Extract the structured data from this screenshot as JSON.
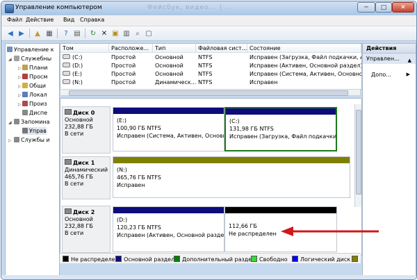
{
  "window": {
    "title": "Управление компьютером",
    "ghost_title": "Фейсбук, видео... | ...",
    "btn_min": "─",
    "btn_max": "□",
    "btn_close": "✕"
  },
  "menu": [
    "Файл",
    "Действие",
    "Вид",
    "Справка"
  ],
  "toolbar_icons": [
    "back-arrow-icon",
    "forward-arrow-icon",
    "folder-up-icon",
    "console-tree-icon",
    "help-icon",
    "view-icon",
    "refresh-icon",
    "delete-icon",
    "export-icon",
    "properties-icon",
    "zoom-icon",
    "new-window-icon"
  ],
  "tree": {
    "root": "Управление к",
    "items": [
      {
        "label": "Служебны",
        "indent": 1
      },
      {
        "label": "Плани",
        "indent": 2
      },
      {
        "label": "Просм",
        "indent": 2
      },
      {
        "label": "Общи",
        "indent": 2
      },
      {
        "label": "Локал",
        "indent": 2
      },
      {
        "label": "Произ",
        "indent": 2
      },
      {
        "label": "Диспе",
        "indent": 2
      },
      {
        "label": "Запомина",
        "indent": 1
      },
      {
        "label": "Управ",
        "indent": 2
      },
      {
        "label": "Службы и",
        "indent": 1
      }
    ]
  },
  "volumes": {
    "headers": [
      "Том",
      "Расположе...",
      "Тип",
      "Файловая сист...",
      "Состояние"
    ],
    "rows": [
      [
        "(C:)",
        "Простой",
        "Основной",
        "NTFS",
        "Исправен (Загрузка, Файл подкачки, Ак"
      ],
      [
        "(D:)",
        "Простой",
        "Основной",
        "NTFS",
        "Исправен (Активен, Основной раздел)"
      ],
      [
        "(E:)",
        "Простой",
        "Основной",
        "NTFS",
        "Исправен (Система, Активен, Основной"
      ],
      [
        "(N:)",
        "Простой",
        "Динамическ...",
        "NTFS",
        "Исправен"
      ]
    ]
  },
  "disks": [
    {
      "name": "Диск 0",
      "type": "Основной",
      "size": "232,88 ГБ",
      "status": "В сети",
      "partitions": [
        {
          "name": "(E:)",
          "size": "100,90 ГБ NTFS",
          "status": "Исправен (Система, Активен, Основн",
          "color": "#0c0c7c"
        },
        {
          "name": "(C:)",
          "size": "131,98 ГБ NTFS",
          "status": "Исправен (Загрузка, Файл подкачки,",
          "color": "#0c0c7c"
        }
      ]
    },
    {
      "name": "Диск 1",
      "type": "Динамический",
      "size": "465,76 ГБ",
      "status": "В сети",
      "partitions": [
        {
          "name": "(N:)",
          "size": "465,76 ГБ NTFS",
          "status": "Исправен",
          "color": "#808000"
        }
      ]
    },
    {
      "name": "Диск 2",
      "type": "Основной",
      "size": "232,88 ГБ",
      "status": "В сети",
      "partitions": [
        {
          "name": "(D:)",
          "size": "120,23 ГБ NTFS",
          "status": "Исправен (Активен, Основной раздел",
          "color": "#0c0c7c"
        },
        {
          "name": "",
          "size": "112,66 ГБ",
          "status": "Не распределен",
          "color": "#000000"
        }
      ]
    }
  ],
  "legend": [
    {
      "label": "Не распределен",
      "color": "#000000"
    },
    {
      "label": "Основной раздел",
      "color": "#0c0c7c"
    },
    {
      "label": "Дополнительный раздел",
      "color": "#008000"
    },
    {
      "label": "Свободно",
      "color": "#33dd33"
    },
    {
      "label": "Логический диск",
      "color": "#0000ff"
    },
    {
      "label": "",
      "color": "#808000"
    }
  ],
  "actions": {
    "header": "Действия",
    "sub": "Управлен...",
    "more": "Допо...",
    "sub_arrow": "▲",
    "more_arrow": "▶"
  },
  "colors": {
    "selected_border": "#1a7a1a",
    "annotation_arrow": "#d01818"
  }
}
